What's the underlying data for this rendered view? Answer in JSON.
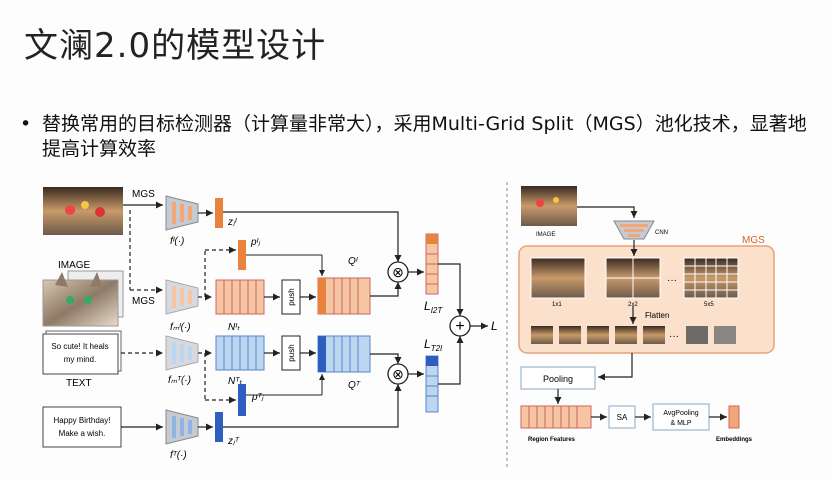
{
  "slide": {
    "title": "文澜2.0的模型设计",
    "bullet": "替换常用的目标检测器（计算量非常大），采用Multi-Grid Split（MGS）池化技术，显著地提高计算效率",
    "bullet_marker": "•"
  },
  "left_diagram": {
    "mgs_top": "MGS",
    "mgs_bottom": "MGS",
    "image_label": "IMAGE",
    "text_label": "TEXT",
    "text_box1_line1": "So cute! It heals",
    "text_box1_line2": "my mind.",
    "text_box2_line1": "Happy Birthday!",
    "text_box2_line2": "Make a wish.",
    "f_i": "fᴵ(·)",
    "f_m_i": "fₘᴵ(·)",
    "f_m_t": "fₘᵀ(·)",
    "f_t": "fᵀ(·)",
    "z_i": "zⱼᴵ",
    "z_t": "zⱼᵀ",
    "p_i": "pᴵⱼ",
    "p_t": "pᵀⱼ",
    "n_i": "Nᴵₜ",
    "n_t": "Nᵀₜ",
    "q_i": "Qᴵ",
    "q_t": "Qᵀ",
    "push1": "push",
    "push2": "push",
    "l_i2t": "L",
    "l_i2t_sub": "I2T",
    "l_t2i": "L",
    "l_t2i_sub": "T2I",
    "l_out": "L",
    "otimes": "⊗",
    "oplus": "+"
  },
  "right_diagram": {
    "image_label": "IMAGE",
    "cnn_label": "CNN",
    "mgs_label": "MGS",
    "grid1": "1x1",
    "grid2": "2x2",
    "grid3": "5x5",
    "ellipsis": "···",
    "flatten": "Flatten",
    "pooling": "Pooling",
    "sa": "SA",
    "avgpool_line1": "AvgPooling",
    "avgpool_line2": "& MLP",
    "region_features": "Region Features",
    "embeddings": "Embeddings"
  },
  "colors": {
    "orange": "#f2a778",
    "orange_dark": "#e8823c",
    "blue": "#a9c8ea",
    "blue_dark": "#2e5fbf",
    "mgs_bg": "#fbe0cc",
    "mgs_border": "#e8a27a"
  }
}
